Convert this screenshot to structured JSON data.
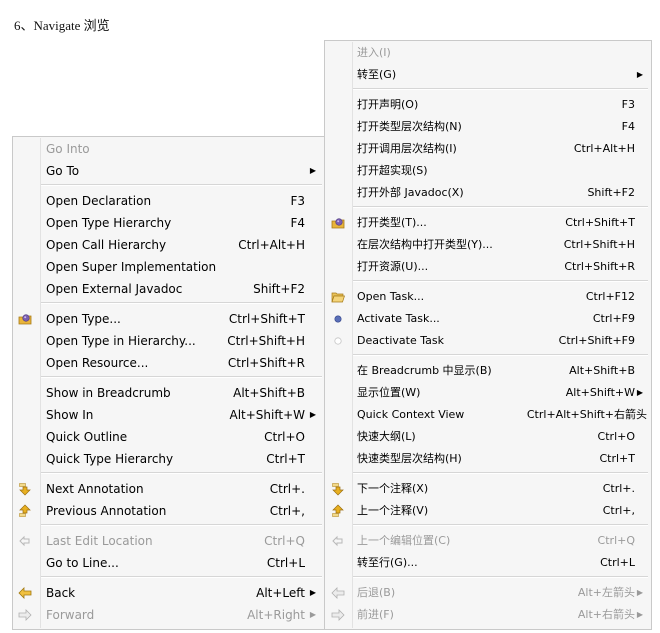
{
  "heading": "6、Navigate 浏览",
  "menu_en": {
    "go_into": "Go Into",
    "go_to": "Go To",
    "open_declaration": "Open Declaration",
    "open_declaration_acc": "F3",
    "open_type_hierarchy": "Open Type Hierarchy",
    "open_type_hierarchy_acc": "F4",
    "open_call_hierarchy": "Open Call Hierarchy",
    "open_call_hierarchy_acc": "Ctrl+Alt+H",
    "open_super_impl": "Open Super Implementation",
    "open_external_javadoc": "Open External Javadoc",
    "open_external_javadoc_acc": "Shift+F2",
    "open_type": "Open Type...",
    "open_type_acc": "Ctrl+Shift+T",
    "open_type_in_hierarchy": "Open Type in Hierarchy...",
    "open_type_in_hierarchy_acc": "Ctrl+Shift+H",
    "open_resource": "Open Resource...",
    "open_resource_acc": "Ctrl+Shift+R",
    "show_in_breadcrumb": "Show in Breadcrumb",
    "show_in_breadcrumb_acc": "Alt+Shift+B",
    "show_in": "Show In",
    "show_in_acc": "Alt+Shift+W",
    "quick_outline": "Quick Outline",
    "quick_outline_acc": "Ctrl+O",
    "quick_type_hierarchy": "Quick Type Hierarchy",
    "quick_type_hierarchy_acc": "Ctrl+T",
    "next_annotation": "Next Annotation",
    "next_annotation_acc": "Ctrl+.",
    "previous_annotation": "Previous Annotation",
    "previous_annotation_acc": "Ctrl+,",
    "last_edit_location": "Last Edit Location",
    "last_edit_location_acc": "Ctrl+Q",
    "go_to_line": "Go to Line...",
    "go_to_line_acc": "Ctrl+L",
    "back": "Back",
    "back_acc": "Alt+Left",
    "forward": "Forward",
    "forward_acc": "Alt+Right"
  },
  "menu_zh": {
    "go_into": "进入(I)",
    "go_to": "转至(G)",
    "open_declaration": "打开声明(O)",
    "open_declaration_acc": "F3",
    "open_type_hierarchy": "打开类型层次结构(N)",
    "open_type_hierarchy_acc": "F4",
    "open_call_hierarchy": "打开调用层次结构(I)",
    "open_call_hierarchy_acc": "Ctrl+Alt+H",
    "open_super_impl": "打开超实现(S)",
    "open_external_javadoc": "打开外部 Javadoc(X)",
    "open_external_javadoc_acc": "Shift+F2",
    "open_type": "打开类型(T)...",
    "open_type_acc": "Ctrl+Shift+T",
    "open_type_in_hierarchy": "在层次结构中打开类型(Y)...",
    "open_type_in_hierarchy_acc": "Ctrl+Shift+H",
    "open_resource": "打开资源(U)...",
    "open_resource_acc": "Ctrl+Shift+R",
    "open_task": "Open Task...",
    "open_task_acc": "Ctrl+F12",
    "activate_task": "Activate Task...",
    "activate_task_acc": "Ctrl+F9",
    "deactivate_task": "Deactivate Task",
    "deactivate_task_acc": "Ctrl+Shift+F9",
    "show_in_breadcrumb": "在 Breadcrumb 中显示(B)",
    "show_in_breadcrumb_acc": "Alt+Shift+B",
    "show_in": "显示位置(W)",
    "show_in_acc": "Alt+Shift+W",
    "quick_context_view": "Quick Context View",
    "quick_context_view_acc": "Ctrl+Alt+Shift+右箭头",
    "quick_outline": "快速大纲(L)",
    "quick_outline_acc": "Ctrl+O",
    "quick_type_hierarchy": "快速类型层次结构(H)",
    "quick_type_hierarchy_acc": "Ctrl+T",
    "next_annotation": "下一个注释(X)",
    "next_annotation_acc": "Ctrl+.",
    "previous_annotation": "上一个注释(V)",
    "previous_annotation_acc": "Ctrl+,",
    "last_edit_location": "上一个编辑位置(C)",
    "last_edit_location_acc": "Ctrl+Q",
    "go_to_line": "转至行(G)...",
    "go_to_line_acc": "Ctrl+L",
    "back": "后退(B)",
    "back_acc": "Alt+左箭头",
    "forward": "前进(F)",
    "forward_acc": "Alt+右箭头"
  },
  "colors": {
    "menu_bg": "#f6f6f6",
    "disabled_text": "#9a9a9a",
    "separator": "#d6d6d6",
    "arrow_yellow": "#e8b020",
    "task_blue": "#5a6fb8"
  },
  "icons": {
    "open_type": "open-type-icon",
    "open_task": "folder-open-icon",
    "activate_task": "active-task-dot-icon",
    "deactivate_task": "inactive-task-dot-icon",
    "next_annotation": "down-arrow-annotation-icon",
    "previous_annotation": "up-arrow-annotation-icon",
    "last_edit_location": "last-edit-icon",
    "back": "back-arrow-icon",
    "forward": "forward-arrow-icon",
    "submenu": "chevron-right-icon"
  }
}
